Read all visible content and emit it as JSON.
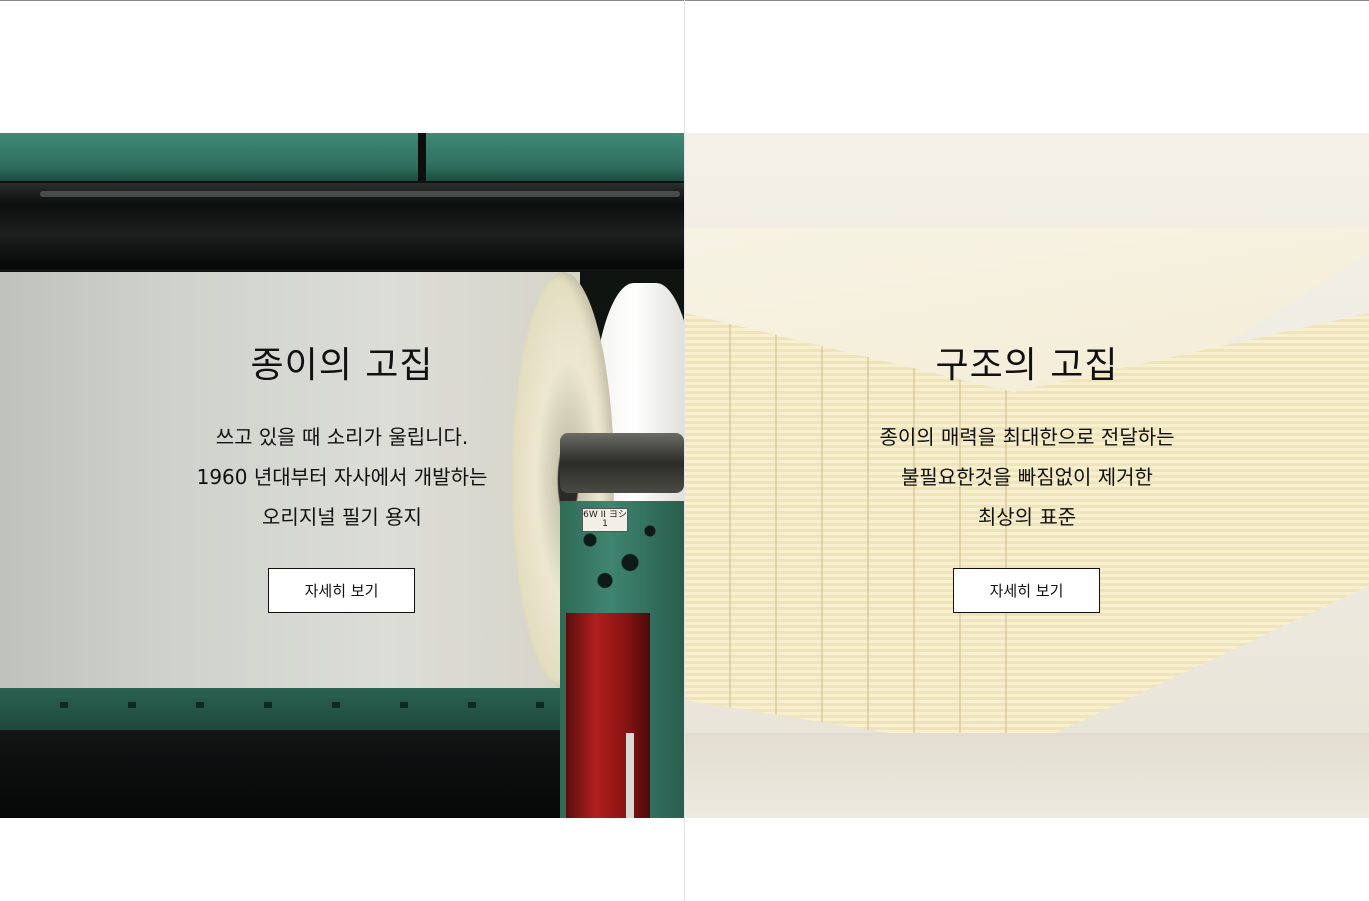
{
  "panels": [
    {
      "title": "종이의 고집",
      "description": [
        "쓰고 있을 때 소리가 울립니다.",
        "1960 년대부터 자사에서 개발하는",
        "오리지널 필기 용지"
      ],
      "button_label": "자세히 보기"
    },
    {
      "title": "구조의 고집",
      "description": [
        "종이의 매력을 최대한으로 전달하는",
        "불필요한것을 빠짐없이 제거한",
        "최상의 표준"
      ],
      "button_label": "자세히 보기"
    }
  ],
  "machine_tag_text": "6W II\nヨシ 1",
  "colors": {
    "text": "#111111",
    "button_bg": "#ffffff",
    "button_border": "#111111",
    "divider": "#e3e3e3"
  }
}
